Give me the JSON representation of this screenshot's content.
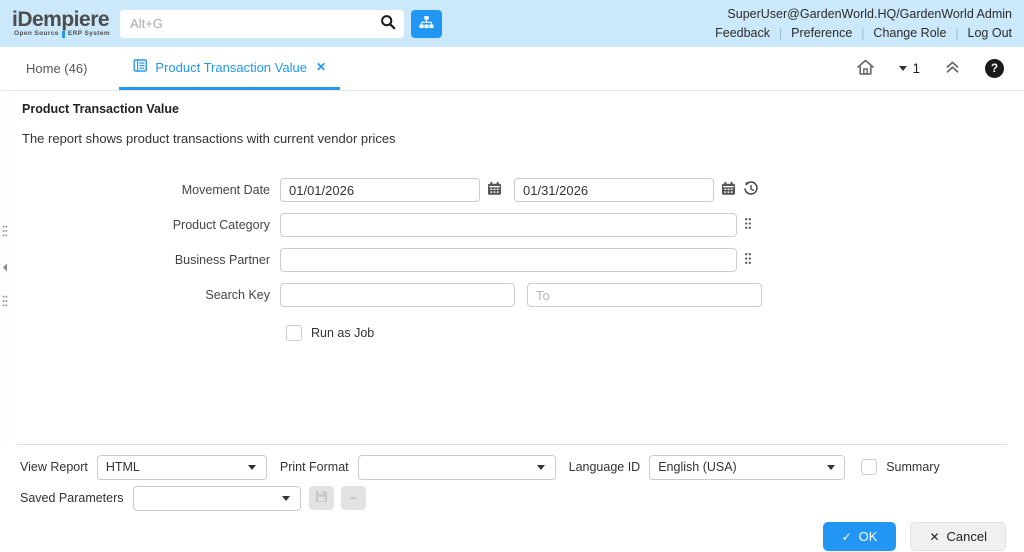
{
  "header": {
    "logo": {
      "title": "iDempiere",
      "tagline_left": "Open Source",
      "tagline_right": "ERP System"
    },
    "search": {
      "placeholder": "Alt+G"
    },
    "user_info": "SuperUser@GardenWorld.HQ/GardenWorld Admin",
    "menu": {
      "feedback": "Feedback",
      "preference": "Preference",
      "change_role": "Change Role",
      "log_out": "Log Out"
    }
  },
  "tabbar": {
    "home_tab": "Home (46)",
    "active_tab": "Product Transaction Value",
    "window_count": "1",
    "help_glyph": "?"
  },
  "process": {
    "title": "Product Transaction Value",
    "description": "The report shows product transactions with current vendor prices",
    "movement_date": {
      "label": "Movement Date",
      "from_value": "01/01/2026",
      "to_value": "01/31/2026"
    },
    "product_category": {
      "label": "Product Category",
      "value": ""
    },
    "business_partner": {
      "label": "Business Partner",
      "value": ""
    },
    "search_key": {
      "label": "Search Key",
      "value": "",
      "to_placeholder": "To"
    },
    "run_as_job": {
      "label": "Run as Job",
      "checked": false
    }
  },
  "footer": {
    "view_report": {
      "label": "View Report",
      "value": "HTML"
    },
    "print_format": {
      "label": "Print Format",
      "value": ""
    },
    "language_id": {
      "label": "Language ID",
      "value": "English (USA)"
    },
    "summary": {
      "label": "Summary",
      "checked": false
    },
    "saved_parameters": {
      "label": "Saved Parameters",
      "value": ""
    },
    "ok_label": "OK",
    "cancel_label": "Cancel"
  },
  "icons": {
    "ok_check": "✓",
    "cancel_x": "✕",
    "tab_close": "✕",
    "minus": "−"
  },
  "colors": {
    "accent": "#2196f3",
    "header_bg": "#cce9fb"
  }
}
